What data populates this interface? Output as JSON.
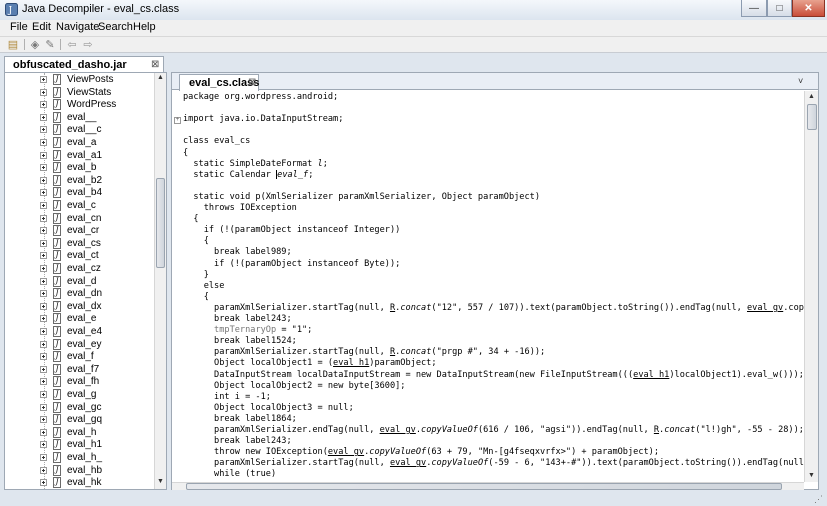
{
  "window": {
    "title": "Java Decompiler - eval_cs.class",
    "buttons": {
      "minimize": "—",
      "maximize": "□",
      "close": "✕"
    }
  },
  "menu": [
    "File",
    "Edit",
    "Navigate",
    "Search",
    "Help"
  ],
  "toolbar": {
    "icons": [
      "open-file-icon",
      "save-icon",
      "settings-icon",
      "back-arrow-icon",
      "forward-arrow-icon"
    ],
    "glyphs": [
      "▤",
      "◈",
      "✎",
      "⇦",
      "⇨"
    ]
  },
  "left_panel": {
    "tab_label": "obfuscated_dasho.jar",
    "close": "⊠",
    "tree_items": [
      "ViewPosts",
      "ViewStats",
      "WordPress",
      "eval__",
      "eval__c",
      "eval_a",
      "eval_a1",
      "eval_b",
      "eval_b2",
      "eval_b4",
      "eval_c",
      "eval_cn",
      "eval_cr",
      "eval_cs",
      "eval_ct",
      "eval_cz",
      "eval_d",
      "eval_dn",
      "eval_dx",
      "eval_e",
      "eval_e4",
      "eval_ey",
      "eval_f",
      "eval_f7",
      "eval_fh",
      "eval_g",
      "eval_gc",
      "eval_gq",
      "eval_h",
      "eval_h1",
      "eval_h_",
      "eval_hb",
      "eval_hk"
    ],
    "file_glyph": "J"
  },
  "editor": {
    "tab_label": "eval_cs.class",
    "close": "⊠",
    "tab_menu": "˅",
    "code_lines": [
      "package org.wordpress.android;",
      "",
      "import java.io.DataInputStream;",
      "",
      "class eval_cs",
      "{",
      "  static SimpleDateFormat l;",
      "  static Calendar |eval_f;",
      "",
      "  static void p(XmlSerializer paramXmlSerializer, Object paramObject)",
      "    throws IOException",
      "  {",
      "    if (!(paramObject instanceof Integer))",
      "    {",
      "      break label989;",
      "      if (!(paramObject instanceof Byte));",
      "    }",
      "    else",
      "    {",
      "      paramXmlSerializer.startTag(null, R.concat(\"12\", 557 / 107)).text(paramObject.toString()).endTag(null, eval_gv.copyValueOf",
      "      break label243;",
      "      tmpTernaryOp = \"1\";",
      "      break label1524;",
      "      paramXmlSerializer.startTag(null, R.concat(\"prgp #\", 34 + -16));",
      "      Object localObject1 = (eval_h1)paramObject;",
      "      DataInputStream localDataInputStream = new DataInputStream(new FileInputStream(((eval_h1)localObject1).eval_w()));",
      "      Object localObject2 = new byte[3600];",
      "      int i = -1;",
      "      Object localObject3 = null;",
      "      break label1864;",
      "      paramXmlSerializer.endTag(null, eval_gv.copyValueOf(616 / 106, \"agsi\")).endTag(null, R.concat(\"l!)gh\", -55 - 28));",
      "      break label243;",
      "      throw new IOException(eval_gv.copyValueOf(63 + 79, \"Mn-[g4fseqxvrfx>\") + paramObject);",
      "      paramXmlSerializer.startTag(null, eval_gv.copyValueOf(-59 - 6, \"143+-#\")).text(paramObject.toString()).endTag(null, eval_c",
      "      while (true)"
    ]
  }
}
